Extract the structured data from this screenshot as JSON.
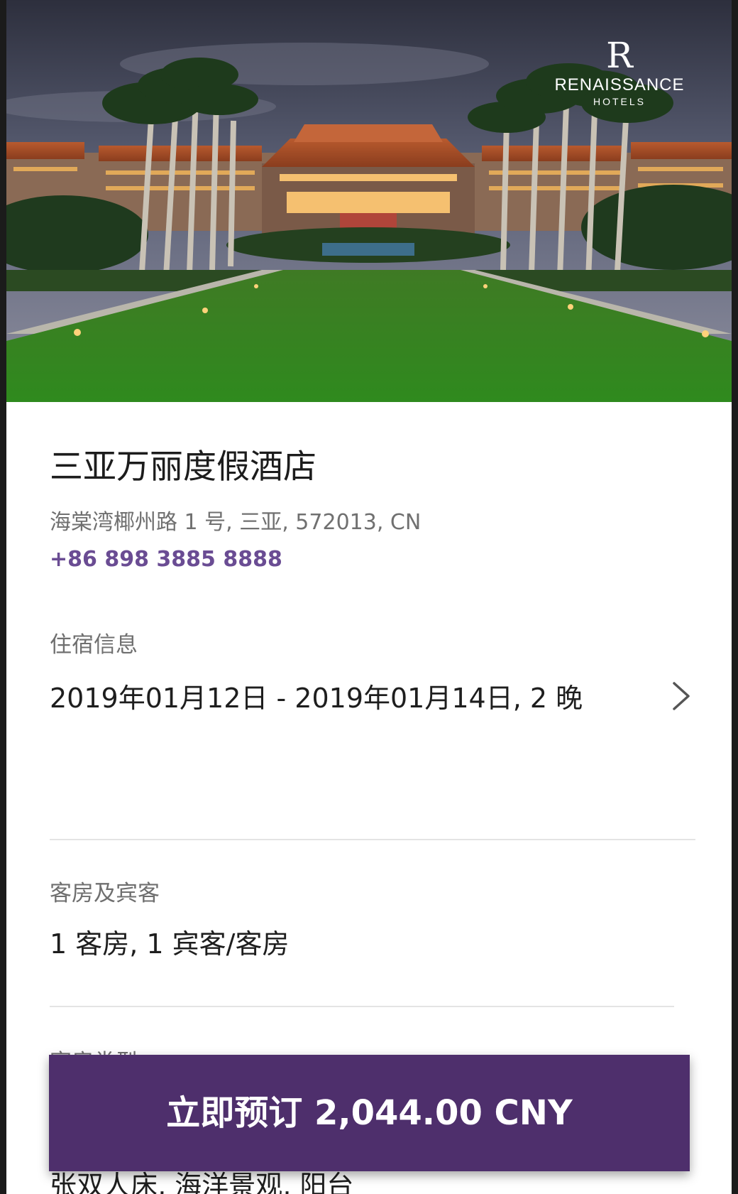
{
  "hero": {
    "brand": {
      "mark": "R",
      "name": "RENAISSANCE",
      "sub": "HOTELS"
    }
  },
  "hotel": {
    "name": "三亚万丽度假酒店",
    "address": "海棠湾椰州路 1 号, 三亚, 572013, CN",
    "phone": "+86 898 3885 8888"
  },
  "stay": {
    "label": "住宿信息",
    "value": "2019年01月12日 - 2019年01月14日, 2 晚"
  },
  "rooms": {
    "label": "客房及宾客",
    "value": "1 客房, 1 宾客/客房"
  },
  "room_type": {
    "label": "客房类型",
    "value": "张双人床, 海洋景观, 阳台"
  },
  "cta": {
    "label": "立即预订 2,044.00 CNY"
  },
  "colors": {
    "accent": "#4e2f6c",
    "link": "#6a4c93",
    "text": "#1e1e1e",
    "muted": "#707070"
  }
}
